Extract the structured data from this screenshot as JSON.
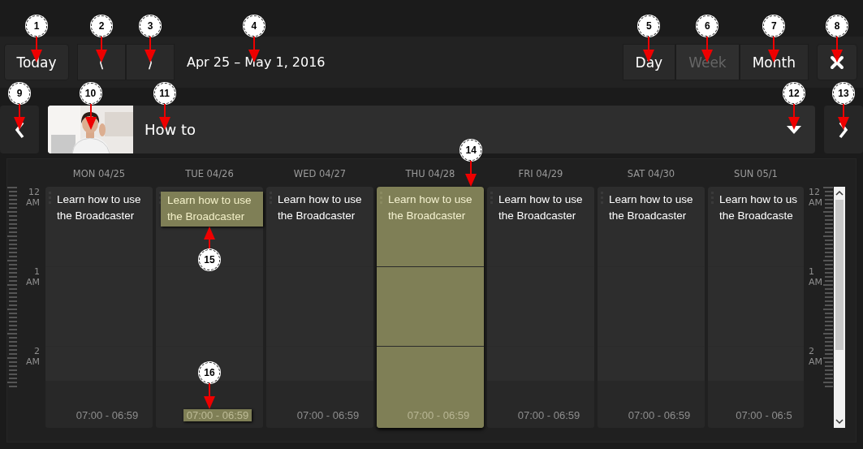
{
  "toolbar": {
    "today_button": {
      "label": "Today",
      "callout": {
        "number": "1"
      }
    },
    "nav_buttons": [
      {
        "label": "⟨",
        "callout": {
          "number": "2"
        }
      },
      {
        "label": "⟩",
        "callout": {
          "number": "3"
        }
      }
    ],
    "date_range": {
      "text": "Apr 25 – May 1, 2016",
      "callout": {
        "number": "4"
      }
    },
    "view_tabs": [
      {
        "label": "Day",
        "selected": false,
        "callout": {
          "number": "5"
        }
      },
      {
        "label": "Week",
        "selected": true,
        "callout": {
          "number": "6"
        }
      },
      {
        "label": "Month",
        "selected": false,
        "callout": {
          "number": "7"
        }
      }
    ],
    "close_button": {
      "callout": {
        "number": "8"
      }
    }
  },
  "channel_bar": {
    "prev_button": {
      "callout": {
        "number": "9"
      }
    },
    "thumbnail": {
      "callout": {
        "number": "10"
      }
    },
    "title": {
      "text": "How to",
      "callout": {
        "number": "11"
      }
    },
    "dropdown": {
      "callout": {
        "number": "12"
      }
    },
    "next_button": {
      "callout": {
        "number": "13"
      }
    }
  },
  "calendar": {
    "left_hours": [
      {
        "text": "12 AM"
      },
      {
        "text": "1 AM"
      },
      {
        "text": "2 AM"
      }
    ],
    "days": [
      {
        "header": "MON 04/25",
        "selected": false,
        "event": {
          "title": "Learn how to use the Broadcaster",
          "highlighted": false
        },
        "time": {
          "text": "07:00 - 06:59",
          "highlighted": false
        }
      },
      {
        "header": "TUE 04/26",
        "selected": false,
        "event": {
          "title": "Learn how to use the Broadcaster",
          "highlighted": true,
          "callout": {
            "number": "15"
          }
        },
        "time": {
          "text": "07:00 - 06:59",
          "highlighted": true,
          "callout": {
            "number": "16"
          }
        }
      },
      {
        "header": "WED 04/27",
        "selected": false,
        "event": {
          "title": "Learn how to use the Broadcaster",
          "highlighted": false
        },
        "time": {
          "text": "07:00 - 06:59",
          "highlighted": false
        }
      },
      {
        "header": "THU 04/28",
        "selected": true,
        "callout": {
          "number": "14"
        },
        "event": {
          "title": "Learn how to use the Broadcaster",
          "highlighted": false
        },
        "time": {
          "text": "07:00 - 06:59",
          "highlighted": false
        }
      },
      {
        "header": "FRI 04/29",
        "selected": false,
        "event": {
          "title": "Learn how to use the Broadcaster",
          "highlighted": false
        },
        "time": {
          "text": "07:00 - 06:59",
          "highlighted": false
        }
      },
      {
        "header": "SAT 04/30",
        "selected": false,
        "event": {
          "title": "Learn how to use the Broadcaster",
          "highlighted": false
        },
        "time": {
          "text": "07:00 - 06:59",
          "highlighted": false
        }
      },
      {
        "header": "SUN 05/1",
        "selected": false,
        "event": {
          "title": "Learn how to us the Broadcaste",
          "highlighted": false
        },
        "time": {
          "text": "07:00 - 06:5",
          "highlighted": false
        }
      }
    ],
    "right_hours": [
      {
        "text": "12 AM"
      },
      {
        "text": "1 AM"
      },
      {
        "text": "2 AM"
      }
    ]
  }
}
